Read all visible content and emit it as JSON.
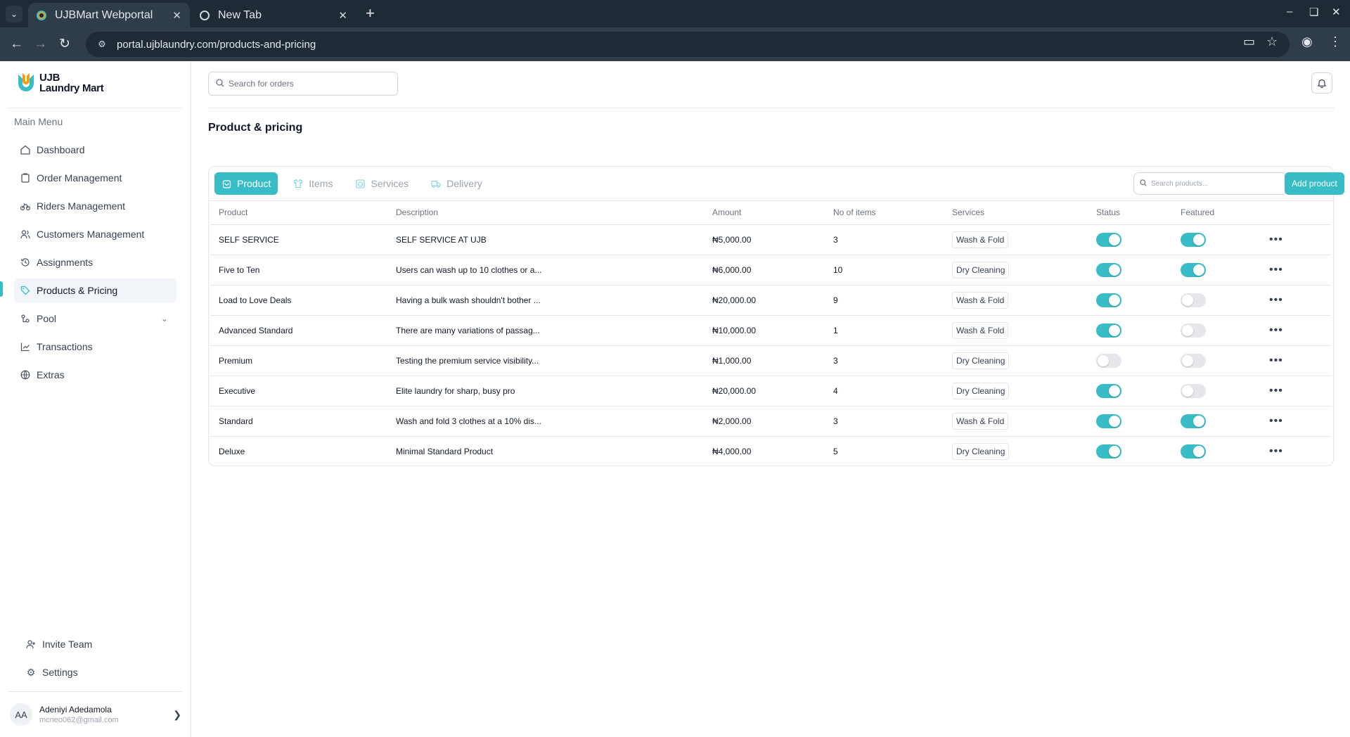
{
  "browser": {
    "tabs": [
      {
        "title": "UJBMart Webportal",
        "active": true
      },
      {
        "title": "New Tab",
        "active": false
      }
    ],
    "url": "portal.ujblaundry.com/products-and-pricing"
  },
  "sidebar": {
    "logo_line1": "UJB",
    "logo_line2": "Laundry Mart",
    "menu_title": "Main Menu",
    "items": [
      {
        "label": "Dashboard",
        "icon": "home-icon"
      },
      {
        "label": "Order Management",
        "icon": "clipboard-icon"
      },
      {
        "label": "Riders Management",
        "icon": "bike-icon"
      },
      {
        "label": "Customers Management",
        "icon": "users-icon"
      },
      {
        "label": "Assignments",
        "icon": "history-icon"
      },
      {
        "label": "Products & Pricing",
        "icon": "tag-icon",
        "active": true
      },
      {
        "label": "Pool",
        "icon": "pool-icon"
      },
      {
        "label": "Transactions",
        "icon": "chart-line-icon"
      },
      {
        "label": "Extras",
        "icon": "globe-icon"
      }
    ],
    "bottom_items": [
      {
        "label": "Invite Team",
        "icon": "user-plus-icon"
      },
      {
        "label": "Settings",
        "icon": "gear-icon"
      }
    ],
    "user": {
      "initials": "AA",
      "name": "Adeniyi Adedamola",
      "email": "mcneo062@gmail.com"
    }
  },
  "header": {
    "search_placeholder": "Search for orders"
  },
  "page": {
    "title": "Product & pricing",
    "tabs": [
      {
        "label": "Product",
        "icon": "bag-icon",
        "active": true
      },
      {
        "label": "Items",
        "icon": "shirt-icon"
      },
      {
        "label": "Services",
        "icon": "washer-icon"
      },
      {
        "label": "Delivery",
        "icon": "truck-icon"
      }
    ],
    "search_placeholder": "Search products...",
    "add_button": "Add product",
    "accent_color": "#38bdc6",
    "table": {
      "columns": [
        "Product",
        "Description",
        "Amount",
        "No of items",
        "Services",
        "Status",
        "Featured"
      ],
      "rows": [
        {
          "product": "SELF SERVICE",
          "description": "SELF SERVICE AT UJB",
          "amount": "₦5,000.00",
          "items": "3",
          "service": "Wash & Fold",
          "status": true,
          "featured": true
        },
        {
          "product": "Five to Ten",
          "description": "Users can wash up to 10 clothes or a...",
          "amount": "₦6,000.00",
          "items": "10",
          "service": "Dry Cleaning",
          "status": true,
          "featured": true
        },
        {
          "product": "Load to Love Deals",
          "description": "Having a bulk wash shouldn't bother ...",
          "amount": "₦20,000.00",
          "items": "9",
          "service": "Wash & Fold",
          "status": true,
          "featured": false
        },
        {
          "product": "Advanced Standard",
          "description": "There are many variations of passag...",
          "amount": "₦10,000.00",
          "items": "1",
          "service": "Wash & Fold",
          "status": true,
          "featured": false
        },
        {
          "product": "Premium",
          "description": "Testing the premium service visibility...",
          "amount": "₦1,000.00",
          "items": "3",
          "service": "Dry Cleaning",
          "status": false,
          "featured": false
        },
        {
          "product": "Executive",
          "description": "Elite laundry for sharp, busy pro",
          "amount": "₦20,000.00",
          "items": "4",
          "service": "Dry Cleaning",
          "status": true,
          "featured": false
        },
        {
          "product": "Standard",
          "description": "Wash and fold 3 clothes at a 10% dis...",
          "amount": "₦2,000.00",
          "items": "3",
          "service": "Wash & Fold",
          "status": true,
          "featured": true
        },
        {
          "product": "Deluxe",
          "description": "Minimal Standard Product",
          "amount": "₦4,000.00",
          "items": "5",
          "service": "Dry Cleaning",
          "status": true,
          "featured": true
        }
      ]
    }
  }
}
